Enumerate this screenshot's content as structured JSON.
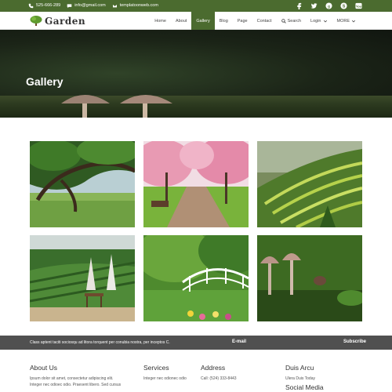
{
  "topbar": {
    "phone": "525-666-289",
    "email": "info@gmail.com",
    "website": "templatoonweb.com",
    "social": [
      "facebook-icon",
      "twitter-icon",
      "google-plus-icon",
      "skype-icon",
      "youtube-icon"
    ]
  },
  "brand": {
    "name": "Garden"
  },
  "nav": {
    "items": [
      "Home",
      "About",
      "Gallery",
      "Blog",
      "Page",
      "Contact",
      "Search",
      "Login",
      "MORE"
    ],
    "active": "Gallery"
  },
  "banner": {
    "title": "Gallery"
  },
  "newsletter": {
    "message": "Class aptent taciti sociosqu ad litora torquent per conubia nostra, per inceptos C.",
    "email_label": "E-mail",
    "subscribe_label": "Subscribe"
  },
  "footer": {
    "about": {
      "title": "About Us",
      "line1": "Ipsum dolor sit amet, consectetur adipiscing elit.",
      "line2": "Integer nec odioec odio. Praesent libero. Sed cursus"
    },
    "services": {
      "title": "Services",
      "line1": "Integer nec odionec odio"
    },
    "address": {
      "title": "Address",
      "line1": "Call: (524) 333-8443"
    },
    "duis": {
      "title": "Duis Arcu",
      "line1": "Ulera Duis Today",
      "social_title": "Social Media"
    }
  },
  "colors": {
    "brand_green": "#4b6b2f",
    "news_bar": "#505050"
  }
}
